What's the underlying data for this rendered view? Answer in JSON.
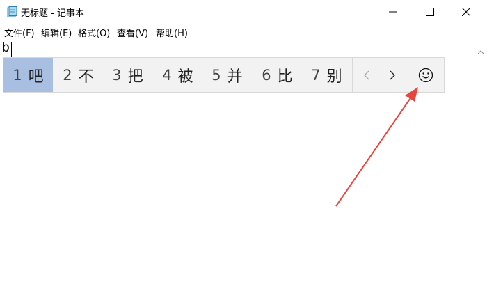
{
  "window": {
    "title": "无标题 - 记事本",
    "icon": "notepad-icon",
    "controls": [
      "minimize-icon",
      "maximize-icon",
      "close-icon"
    ]
  },
  "menu": {
    "items": [
      {
        "label": "文件(F)"
      },
      {
        "label": "编辑(E)"
      },
      {
        "label": "格式(O)"
      },
      {
        "label": "查看(V)"
      },
      {
        "label": "帮助(H)"
      }
    ]
  },
  "editor": {
    "text": "b"
  },
  "ime": {
    "candidates": [
      {
        "num": "1",
        "text": "吧",
        "selected": true
      },
      {
        "num": "2",
        "text": "不"
      },
      {
        "num": "3",
        "text": "把"
      },
      {
        "num": "4",
        "text": "被"
      },
      {
        "num": "5",
        "text": "并"
      },
      {
        "num": "6",
        "text": "比"
      },
      {
        "num": "7",
        "text": "别"
      }
    ],
    "nav_prev": "‹",
    "nav_next": "›",
    "emoji": "☺",
    "highlight_color": "#a8bfe2"
  },
  "annotation": {
    "arrow_color": "#e8453c"
  }
}
